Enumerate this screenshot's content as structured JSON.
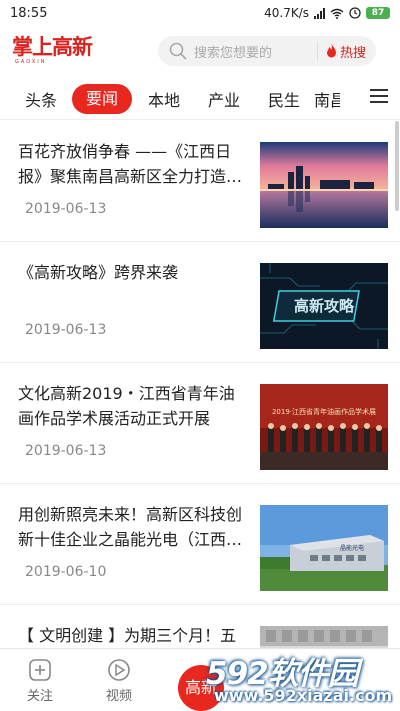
{
  "status_bar": {
    "time": "18:55",
    "network_speed": "40.7K/s",
    "battery": "87"
  },
  "header": {
    "logo_text": "掌上高新",
    "logo_sub": "GAOXIN",
    "search_placeholder": "搜索您想要的",
    "hot_search_label": "热搜"
  },
  "tabs": [
    {
      "label": "头条",
      "active": false
    },
    {
      "label": "要闻",
      "active": true
    },
    {
      "label": "本地",
      "active": false
    },
    {
      "label": "产业",
      "active": false
    },
    {
      "label": "民生",
      "active": false
    },
    {
      "label": "南昌",
      "active": false
    }
  ],
  "news": [
    {
      "title": "百花齐放俏争春 ——《江西日报》聚焦南昌高新区全力打造…",
      "date": "2019-06-13",
      "thumb_icon": "city-skyline-image"
    },
    {
      "title": "《高新攻略》跨界来袭",
      "date": "2019-06-13",
      "thumb_icon": "circuit-board-image",
      "thumb_caption": "高新攻略"
    },
    {
      "title": "文化高新2019・江西省青年油画作品学术展活动正式开展",
      "date": "2019-06-13",
      "thumb_icon": "exhibition-stage-image",
      "thumb_caption": "2019·江西省青年油画作品学术展"
    },
    {
      "title": "用创新照亮未来！高新区科技创新十佳企业之晶能光电（江西…",
      "date": "2019-06-10",
      "thumb_icon": "factory-building-image",
      "thumb_caption": "晶能光电"
    },
    {
      "title": "【 文明创建 】为期三个月！五大",
      "date": "",
      "thumb_icon": "building-image"
    }
  ],
  "bottom_nav": {
    "follow_label": "关注",
    "video_label": "视频",
    "center_label": "高新"
  },
  "watermark": {
    "brand": "592软件园",
    "url": "www.592xiazai.com"
  },
  "colors": {
    "brand_red": "#e8281f",
    "battery_green": "#4caf50"
  }
}
